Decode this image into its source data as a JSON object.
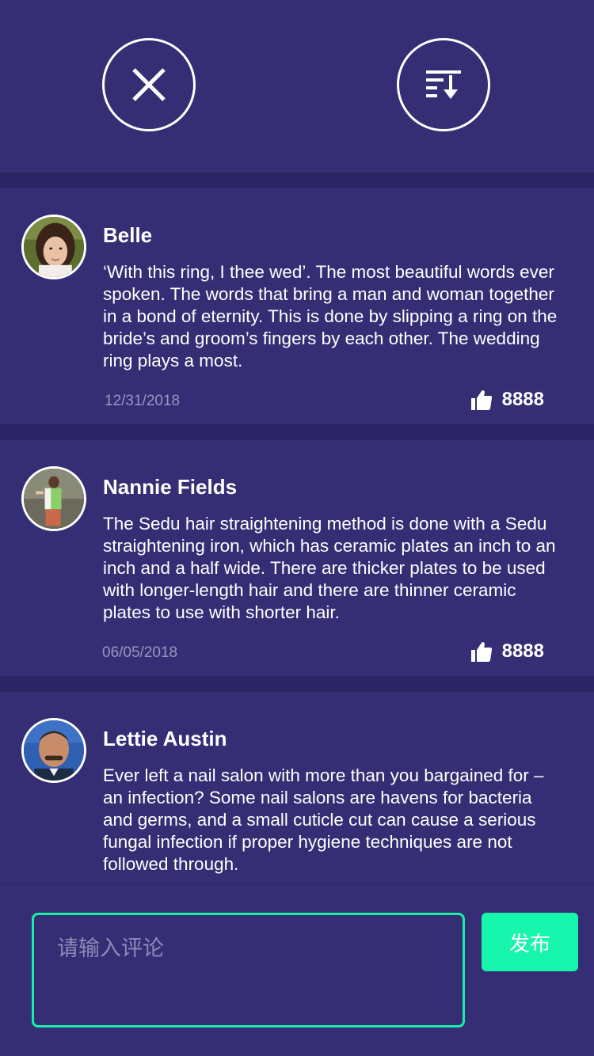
{
  "header": {
    "close_icon": "close-icon",
    "sort_icon": "sort-icon"
  },
  "comments": [
    {
      "name": "Belle",
      "text": "‘With this ring, I thee wed’. The most beautiful words ever spoken. The words that bring a man and woman together in a bond of eternity. This is done by slipping a ring on the bride’s and groom’s fingers by each other.  The wedding ring plays a most.",
      "date": "12/31/2018",
      "likes": "8888"
    },
    {
      "name": "Nannie Fields",
      "text": "The Sedu hair straightening method is done with a Sedu straightening iron, which has ceramic plates an inch to an inch and a half wide. There are thicker plates to be used with longer-length hair and there are thinner ceramic plates to use with shorter hair.",
      "date": "06/05/2018",
      "likes": "8888"
    },
    {
      "name": "Lettie Austin",
      "text": "Ever left a nail salon with more than you bargained for – an infection? Some nail salons are havens for bacteria and germs, and a small cuticle cut can cause a serious fungal infection if proper hygiene techniques are not followed through."
    }
  ],
  "composer": {
    "placeholder": "请输入评论",
    "publish_label": "发布"
  },
  "colors": {
    "background": "#352E74",
    "divider": "#2B2565",
    "accent": "#18F5AC",
    "muted_text": "#9A95C2"
  }
}
